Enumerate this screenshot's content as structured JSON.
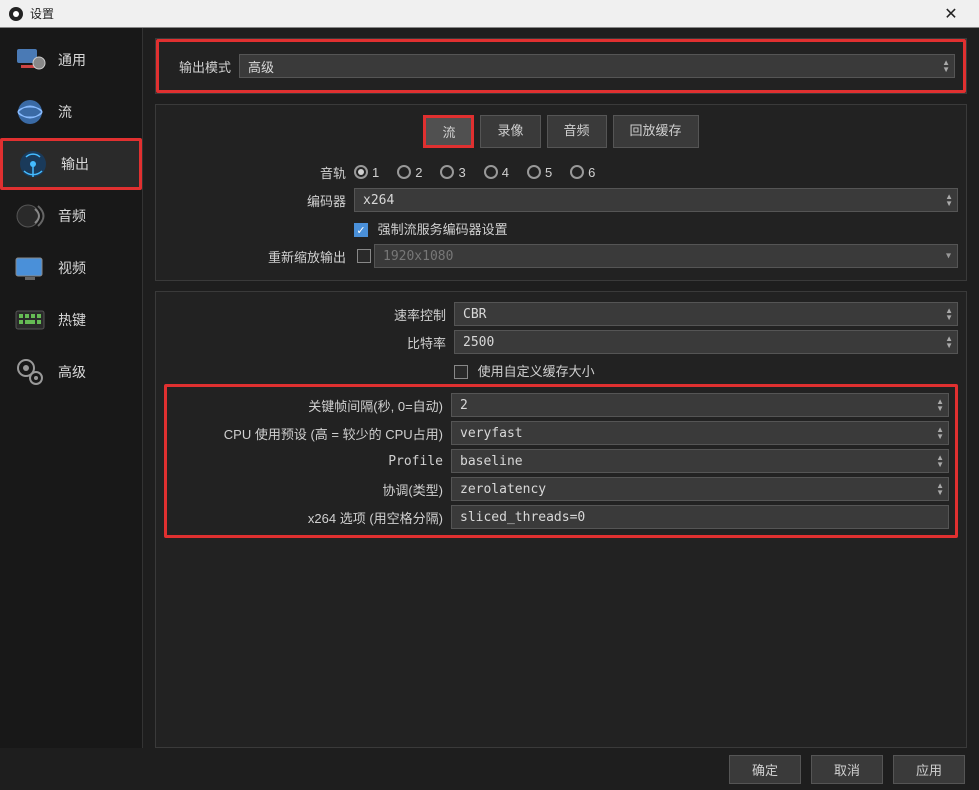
{
  "window": {
    "title": "设置"
  },
  "sidebar": {
    "items": [
      {
        "label": "通用"
      },
      {
        "label": "流"
      },
      {
        "label": "输出"
      },
      {
        "label": "音频"
      },
      {
        "label": "视频"
      },
      {
        "label": "热键"
      },
      {
        "label": "高级"
      }
    ]
  },
  "main": {
    "output_mode_label": "输出模式",
    "output_mode_value": "高级",
    "tabs": [
      {
        "label": "流"
      },
      {
        "label": "录像"
      },
      {
        "label": "音频"
      },
      {
        "label": "回放缓存"
      }
    ],
    "audio_track_label": "音轨",
    "audio_tracks": [
      "1",
      "2",
      "3",
      "4",
      "5",
      "6"
    ],
    "encoder_label": "编码器",
    "encoder_value": "x264",
    "enforce_label": "强制流服务编码器设置",
    "rescale_label": "重新缩放输出",
    "rescale_value": "1920x1080",
    "rate_control_label": "速率控制",
    "rate_control_value": "CBR",
    "bitrate_label": "比特率",
    "bitrate_value": "2500",
    "custom_buffer_label": "使用自定义缓存大小",
    "keyframe_label": "关键帧间隔(秒, 0=自动)",
    "keyframe_value": "2",
    "cpu_preset_label": "CPU 使用预设 (高 = 较少的 CPU占用)",
    "cpu_preset_value": "veryfast",
    "profile_label": "Profile",
    "profile_value": "baseline",
    "tune_label": "协调(类型)",
    "tune_value": "zerolatency",
    "x264opts_label": "x264 选项 (用空格分隔)",
    "x264opts_value": "sliced_threads=0"
  },
  "footer": {
    "ok": "确定",
    "cancel": "取消",
    "apply": "应用"
  }
}
